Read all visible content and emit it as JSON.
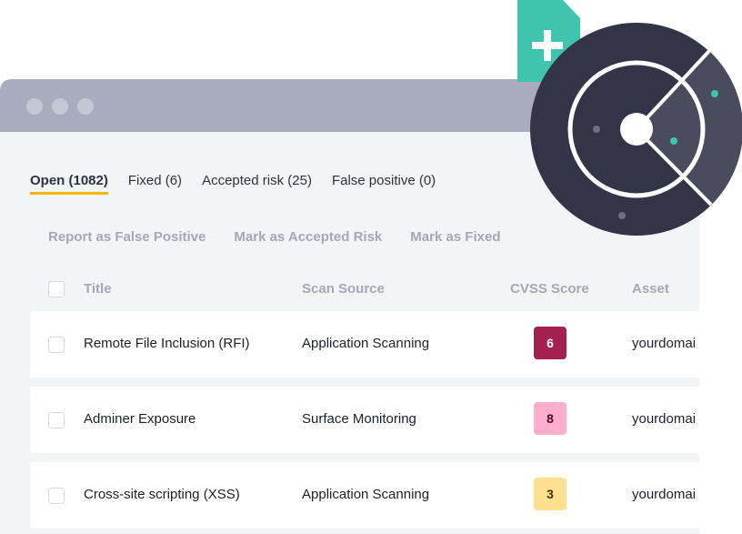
{
  "window": {
    "title_dots": [
      "dot",
      "dot",
      "dot"
    ]
  },
  "tabs": [
    {
      "label": "Open (1082)",
      "active": true
    },
    {
      "label": "Fixed (6)",
      "active": false
    },
    {
      "label": "Accepted risk (25)",
      "active": false
    },
    {
      "label": "False positive (0)",
      "active": false
    }
  ],
  "actions": [
    {
      "label": "Report as False Positive"
    },
    {
      "label": "Mark as Accepted Risk"
    },
    {
      "label": "Mark as Fixed"
    }
  ],
  "table": {
    "columns": [
      "Title",
      "Scan Source",
      "CVSS Score",
      "Asset"
    ],
    "rows": [
      {
        "title": "Remote File Inclusion (RFI)",
        "source": "Application Scanning",
        "score": "6",
        "asset": "yourdomai",
        "badge_bg": "#a3204f",
        "badge_fg": "#ffffff"
      },
      {
        "title": "Adminer Exposure",
        "source": "Surface Monitoring",
        "score": "8",
        "asset": "yourdomai",
        "badge_bg": "#ffadcc",
        "badge_fg": "#4a0b22"
      },
      {
        "title": "Cross-site scripting (XSS)",
        "source": "Application Scanning",
        "score": "3",
        "asset": "yourdomai",
        "badge_bg": "#ffe08f",
        "badge_fg": "#3d2f00"
      }
    ]
  },
  "decorations": {
    "add_document_icon": "add-file-icon",
    "radar_icon": "radar-icon"
  },
  "colors": {
    "accent_tab_underline": "#f7b500",
    "radar_dark": "#333547",
    "radar_sector": "#4a4b5c",
    "teal": "#3fc5ad"
  }
}
